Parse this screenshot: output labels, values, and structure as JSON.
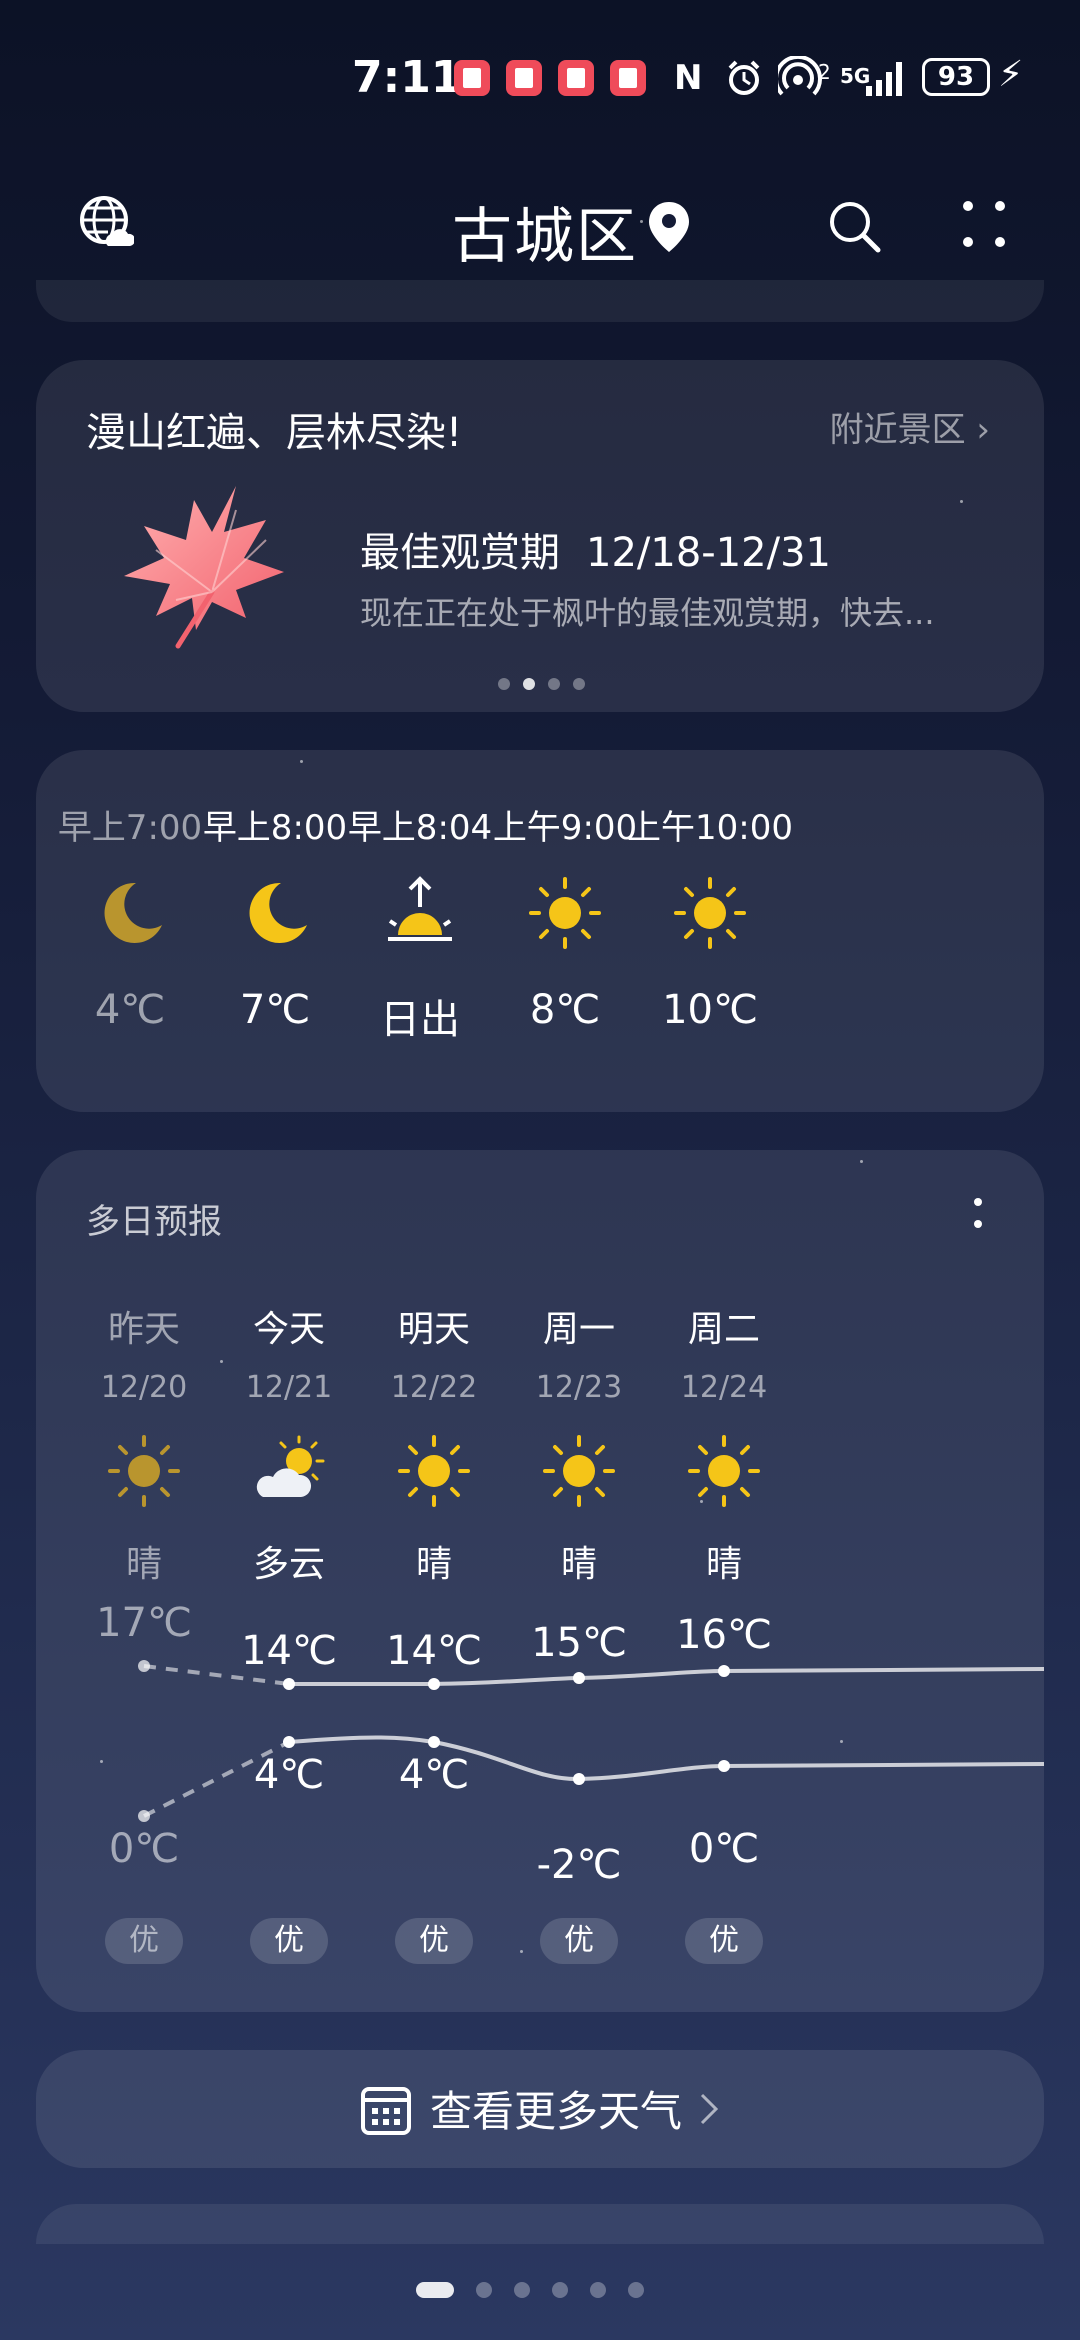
{
  "status_bar": {
    "time": "7:11",
    "network": "5G",
    "sim_index": "2",
    "battery": "93",
    "icons": [
      "note-app-icon",
      "note-app-icon",
      "note-app-icon",
      "note-app-icon",
      "nfc-icon",
      "alarm-icon",
      "hotspot-icon",
      "signal-icon",
      "battery-icon",
      "charging-icon"
    ]
  },
  "header": {
    "location": "古城区",
    "icons": [
      "globe-cloud-icon",
      "location-pin-icon",
      "search-icon",
      "more-icon"
    ]
  },
  "promo": {
    "headline": "漫山红遍、层林尽染!",
    "link": "附近景区",
    "title": "最佳观赏期",
    "dates": "12/18-12/31",
    "description": "现在正在处于枫叶的最佳观赏期，快去...",
    "icon": "maple-leaf-icon",
    "page_count": 4,
    "active_page": 1
  },
  "hourly": [
    {
      "time": "早上7:00",
      "icon": "moon-icon",
      "temp": "4℃",
      "past": true
    },
    {
      "time": "早上8:00",
      "icon": "moon-icon",
      "temp": "7℃",
      "past": false
    },
    {
      "time": "早上8:04",
      "icon": "sunrise-icon",
      "temp": "日出",
      "past": false
    },
    {
      "time": "上午9:00",
      "icon": "sun-icon",
      "temp": "8℃",
      "past": false
    },
    {
      "time": "上午10:00",
      "icon": "sun-icon",
      "temp": "10℃",
      "past": false
    }
  ],
  "daily": {
    "title": "多日预报",
    "days": [
      {
        "day": "昨天",
        "date": "12/20",
        "icon": "sun-icon",
        "condition": "晴",
        "high": "17℃",
        "low": "0℃",
        "aqi": "优"
      },
      {
        "day": "今天",
        "date": "12/21",
        "icon": "partly-cloudy-icon",
        "condition": "多云",
        "high": "14℃",
        "low": "4℃",
        "aqi": "优"
      },
      {
        "day": "明天",
        "date": "12/22",
        "icon": "sun-icon",
        "condition": "晴",
        "high": "14℃",
        "low": "4℃",
        "aqi": "优"
      },
      {
        "day": "周一",
        "date": "12/23",
        "icon": "sun-icon",
        "condition": "晴",
        "high": "15℃",
        "low": "-2℃",
        "aqi": "优"
      },
      {
        "day": "周二",
        "date": "12/24",
        "icon": "sun-icon",
        "condition": "晴",
        "high": "16℃",
        "low": "0℃",
        "aqi": "优"
      }
    ]
  },
  "more_weather": {
    "label": "查看更多天气",
    "icon": "calendar-icon"
  },
  "pager": {
    "count": 6,
    "active": 0
  },
  "colors": {
    "sun": "#f5c518",
    "moon": "#f5c518",
    "leaf": "#ff8a8f",
    "card_bg": "rgba(255,255,255,0.09)"
  }
}
